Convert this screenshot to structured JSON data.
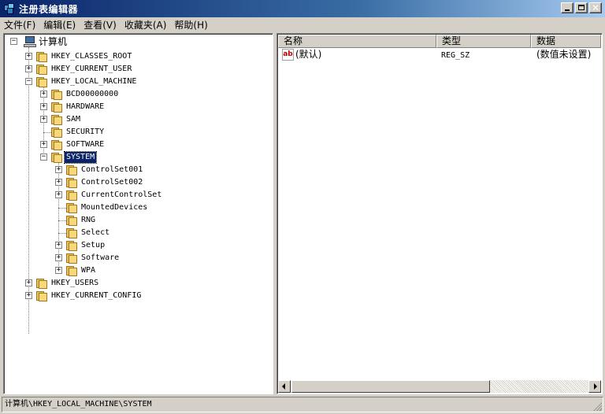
{
  "window": {
    "title": "注册表编辑器"
  },
  "menu": [
    {
      "label": "文件(F)"
    },
    {
      "label": "编辑(E)"
    },
    {
      "label": "查看(V)"
    },
    {
      "label": "收藏夹(A)"
    },
    {
      "label": "帮助(H)"
    }
  ],
  "tree": {
    "root": "计算机",
    "hives": {
      "classes_root": "HKEY_CLASSES_ROOT",
      "current_user": "HKEY_CURRENT_USER",
      "local_machine": "HKEY_LOCAL_MACHINE",
      "users": "HKEY_USERS",
      "current_config": "HKEY_CURRENT_CONFIG"
    },
    "local_machine_children": [
      {
        "label": "BCD00000000",
        "expander": "+"
      },
      {
        "label": "HARDWARE",
        "expander": "+"
      },
      {
        "label": "SAM",
        "expander": "+"
      },
      {
        "label": "SECURITY",
        "expander": ""
      },
      {
        "label": "SOFTWARE",
        "expander": "+"
      },
      {
        "label": "SYSTEM",
        "expander": "-"
      }
    ],
    "system_children": [
      {
        "label": "ControlSet001",
        "expander": "+"
      },
      {
        "label": "ControlSet002",
        "expander": "+"
      },
      {
        "label": "CurrentControlSet",
        "expander": "+"
      },
      {
        "label": "MountedDevices",
        "expander": ""
      },
      {
        "label": "RNG",
        "expander": ""
      },
      {
        "label": "Select",
        "expander": ""
      },
      {
        "label": "Setup",
        "expander": "+"
      },
      {
        "label": "Software",
        "expander": "+"
      },
      {
        "label": "WPA",
        "expander": "+"
      }
    ],
    "selected": "SYSTEM"
  },
  "list": {
    "columns": [
      "名称",
      "类型",
      "数据"
    ],
    "rows": [
      {
        "icon": "ab",
        "name": "(默认)",
        "type": "REG_SZ",
        "data": "(数值未设置)"
      }
    ]
  },
  "status": {
    "path": "计算机\\HKEY_LOCAL_MACHINE\\SYSTEM"
  }
}
